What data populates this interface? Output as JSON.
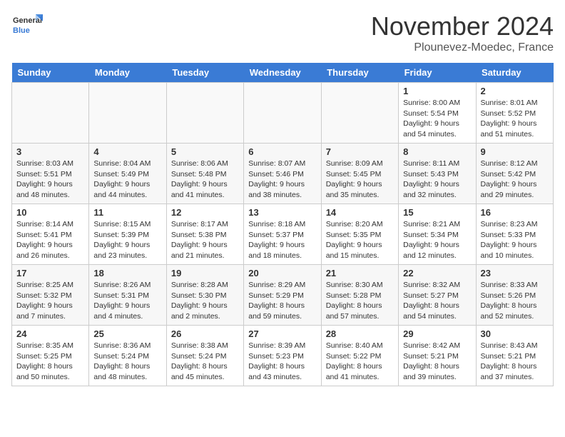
{
  "logo": {
    "text_general": "General",
    "text_blue": "Blue"
  },
  "title": "November 2024",
  "location": "Plounevez-Moedec, France",
  "days_of_week": [
    "Sunday",
    "Monday",
    "Tuesday",
    "Wednesday",
    "Thursday",
    "Friday",
    "Saturday"
  ],
  "weeks": [
    [
      {
        "day": "",
        "info": ""
      },
      {
        "day": "",
        "info": ""
      },
      {
        "day": "",
        "info": ""
      },
      {
        "day": "",
        "info": ""
      },
      {
        "day": "",
        "info": ""
      },
      {
        "day": "1",
        "info": "Sunrise: 8:00 AM\nSunset: 5:54 PM\nDaylight: 9 hours and 54 minutes."
      },
      {
        "day": "2",
        "info": "Sunrise: 8:01 AM\nSunset: 5:52 PM\nDaylight: 9 hours and 51 minutes."
      }
    ],
    [
      {
        "day": "3",
        "info": "Sunrise: 8:03 AM\nSunset: 5:51 PM\nDaylight: 9 hours and 48 minutes."
      },
      {
        "day": "4",
        "info": "Sunrise: 8:04 AM\nSunset: 5:49 PM\nDaylight: 9 hours and 44 minutes."
      },
      {
        "day": "5",
        "info": "Sunrise: 8:06 AM\nSunset: 5:48 PM\nDaylight: 9 hours and 41 minutes."
      },
      {
        "day": "6",
        "info": "Sunrise: 8:07 AM\nSunset: 5:46 PM\nDaylight: 9 hours and 38 minutes."
      },
      {
        "day": "7",
        "info": "Sunrise: 8:09 AM\nSunset: 5:45 PM\nDaylight: 9 hours and 35 minutes."
      },
      {
        "day": "8",
        "info": "Sunrise: 8:11 AM\nSunset: 5:43 PM\nDaylight: 9 hours and 32 minutes."
      },
      {
        "day": "9",
        "info": "Sunrise: 8:12 AM\nSunset: 5:42 PM\nDaylight: 9 hours and 29 minutes."
      }
    ],
    [
      {
        "day": "10",
        "info": "Sunrise: 8:14 AM\nSunset: 5:41 PM\nDaylight: 9 hours and 26 minutes."
      },
      {
        "day": "11",
        "info": "Sunrise: 8:15 AM\nSunset: 5:39 PM\nDaylight: 9 hours and 23 minutes."
      },
      {
        "day": "12",
        "info": "Sunrise: 8:17 AM\nSunset: 5:38 PM\nDaylight: 9 hours and 21 minutes."
      },
      {
        "day": "13",
        "info": "Sunrise: 8:18 AM\nSunset: 5:37 PM\nDaylight: 9 hours and 18 minutes."
      },
      {
        "day": "14",
        "info": "Sunrise: 8:20 AM\nSunset: 5:35 PM\nDaylight: 9 hours and 15 minutes."
      },
      {
        "day": "15",
        "info": "Sunrise: 8:21 AM\nSunset: 5:34 PM\nDaylight: 9 hours and 12 minutes."
      },
      {
        "day": "16",
        "info": "Sunrise: 8:23 AM\nSunset: 5:33 PM\nDaylight: 9 hours and 10 minutes."
      }
    ],
    [
      {
        "day": "17",
        "info": "Sunrise: 8:25 AM\nSunset: 5:32 PM\nDaylight: 9 hours and 7 minutes."
      },
      {
        "day": "18",
        "info": "Sunrise: 8:26 AM\nSunset: 5:31 PM\nDaylight: 9 hours and 4 minutes."
      },
      {
        "day": "19",
        "info": "Sunrise: 8:28 AM\nSunset: 5:30 PM\nDaylight: 9 hours and 2 minutes."
      },
      {
        "day": "20",
        "info": "Sunrise: 8:29 AM\nSunset: 5:29 PM\nDaylight: 8 hours and 59 minutes."
      },
      {
        "day": "21",
        "info": "Sunrise: 8:30 AM\nSunset: 5:28 PM\nDaylight: 8 hours and 57 minutes."
      },
      {
        "day": "22",
        "info": "Sunrise: 8:32 AM\nSunset: 5:27 PM\nDaylight: 8 hours and 54 minutes."
      },
      {
        "day": "23",
        "info": "Sunrise: 8:33 AM\nSunset: 5:26 PM\nDaylight: 8 hours and 52 minutes."
      }
    ],
    [
      {
        "day": "24",
        "info": "Sunrise: 8:35 AM\nSunset: 5:25 PM\nDaylight: 8 hours and 50 minutes."
      },
      {
        "day": "25",
        "info": "Sunrise: 8:36 AM\nSunset: 5:24 PM\nDaylight: 8 hours and 48 minutes."
      },
      {
        "day": "26",
        "info": "Sunrise: 8:38 AM\nSunset: 5:24 PM\nDaylight: 8 hours and 45 minutes."
      },
      {
        "day": "27",
        "info": "Sunrise: 8:39 AM\nSunset: 5:23 PM\nDaylight: 8 hours and 43 minutes."
      },
      {
        "day": "28",
        "info": "Sunrise: 8:40 AM\nSunset: 5:22 PM\nDaylight: 8 hours and 41 minutes."
      },
      {
        "day": "29",
        "info": "Sunrise: 8:42 AM\nSunset: 5:21 PM\nDaylight: 8 hours and 39 minutes."
      },
      {
        "day": "30",
        "info": "Sunrise: 8:43 AM\nSunset: 5:21 PM\nDaylight: 8 hours and 37 minutes."
      }
    ]
  ]
}
